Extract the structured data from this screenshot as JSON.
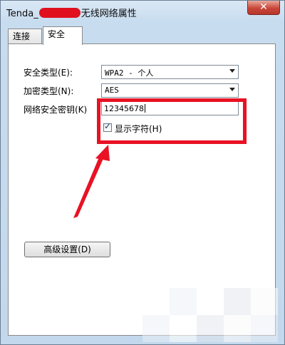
{
  "window": {
    "title_prefix": "Tenda_",
    "title_suffix": "无线网络属性",
    "close_label": "✕"
  },
  "tabs": [
    {
      "label": "连接",
      "active": false
    },
    {
      "label": "安全",
      "active": true
    }
  ],
  "security": {
    "type_label": "安全类型(E):",
    "type_value": "WPA2 - 个人",
    "encryption_label": "加密类型(N):",
    "encryption_value": "AES",
    "key_label": "网络安全密钥(K)",
    "key_value": "12345678",
    "show_chars_label": "显示字符(H)",
    "show_chars_checked": true
  },
  "buttons": {
    "advanced_label": "高级设置(D)"
  },
  "annotation": {
    "highlight_color": "#e81224"
  }
}
